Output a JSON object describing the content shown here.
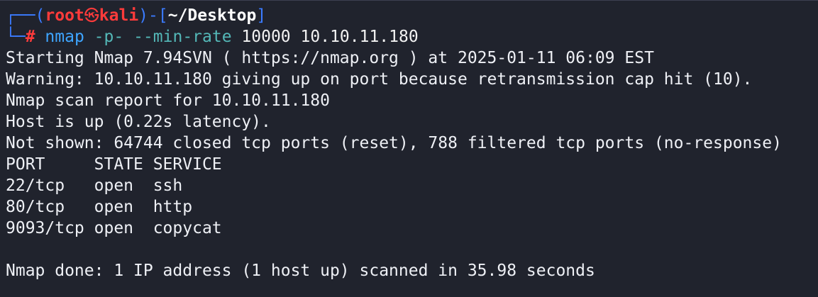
{
  "prompt": {
    "open_bracket": "┌──(",
    "user": "root",
    "skull": "㉿",
    "host": "kali",
    "mid": ")-[",
    "cwd": "~/Desktop",
    "close_bracket": "]",
    "corner": "└─",
    "hash": "#"
  },
  "command": {
    "program": "nmap",
    "flag1": "-p-",
    "flag2": "--min-rate",
    "rate": "10000",
    "target": "10.10.11.180"
  },
  "output": [
    "Starting Nmap 7.94SVN ( https://nmap.org ) at 2025-01-11 06:09 EST",
    "Warning: 10.10.11.180 giving up on port because retransmission cap hit (10).",
    "Nmap scan report for 10.10.11.180",
    "Host is up (0.22s latency).",
    "Not shown: 64744 closed tcp ports (reset), 788 filtered tcp ports (no-response)",
    "PORT     STATE SERVICE",
    "22/tcp   open  ssh",
    "80/tcp   open  http",
    "9093/tcp open  copycat",
    "",
    "Nmap done: 1 IP address (1 host up) scanned in 35.98 seconds"
  ]
}
